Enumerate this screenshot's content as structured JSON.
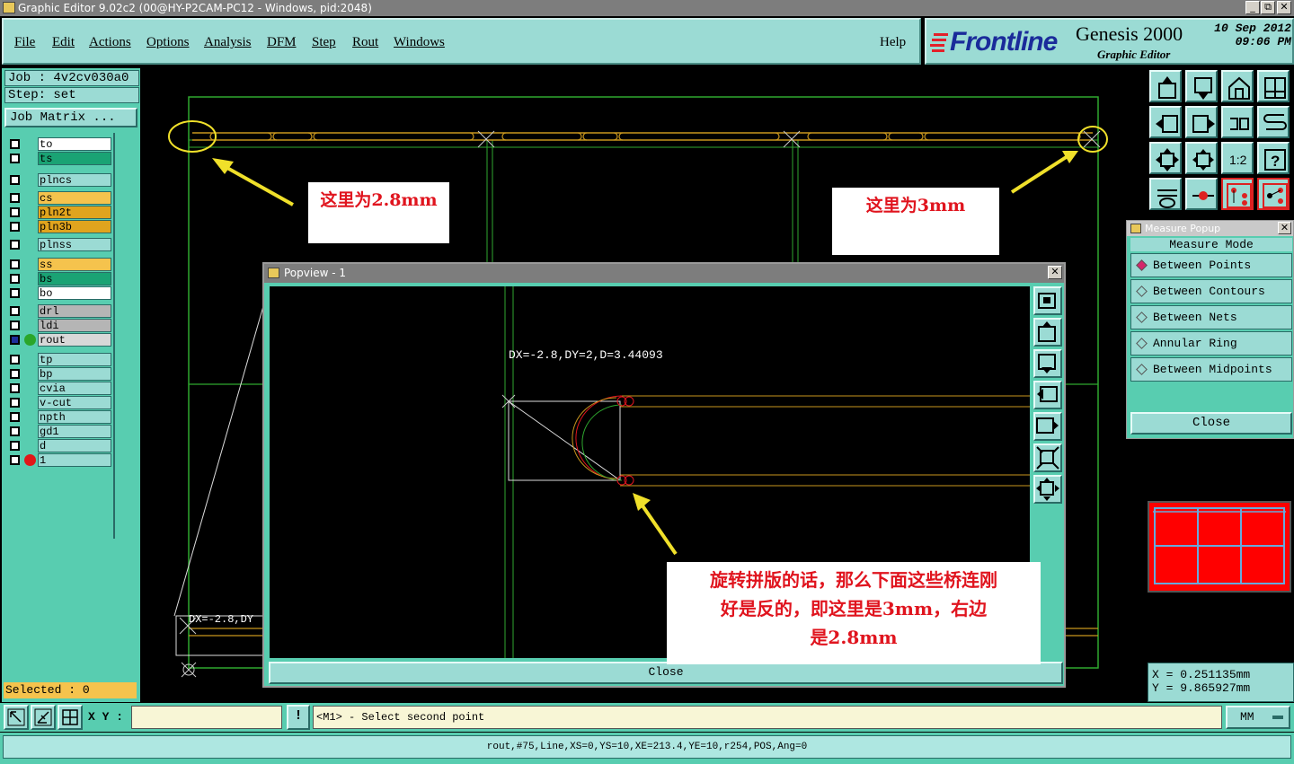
{
  "window": {
    "title": "Graphic Editor 9.02c2 (00@HY-P2CAM-PC12 - Windows, pid:2048)",
    "controls": [
      "_",
      "⧉",
      "✕"
    ]
  },
  "menu": {
    "items": [
      "File",
      "Edit",
      "Actions",
      "Options",
      "Analysis",
      "DFM",
      "Step",
      "Rout",
      "Windows"
    ],
    "help": "Help"
  },
  "brand": {
    "logo": "Frontline",
    "product": "Genesis 2000",
    "subtitle": "Graphic Editor",
    "date": "10  Sep  2012",
    "time": "09:06  PM"
  },
  "job": {
    "job_line": "Job  :  4v2cv030a0",
    "step_line": "Step:  set",
    "matrix_button": "Job Matrix ..."
  },
  "layers": [
    [
      {
        "name": "to",
        "color": "#ffffff"
      },
      {
        "name": "ts",
        "color": "#1aa374"
      }
    ],
    [
      {
        "name": "plncs",
        "color": "#9bdbd4"
      }
    ],
    [
      {
        "name": "cs",
        "color": "#f5c34d"
      },
      {
        "name": "pln2t",
        "color": "#e0a41e"
      },
      {
        "name": "pln3b",
        "color": "#e0a41e"
      }
    ],
    [
      {
        "name": "plnss",
        "color": "#9bdbd4"
      }
    ],
    [
      {
        "name": "ss",
        "color": "#f5c34d"
      },
      {
        "name": "bs",
        "color": "#1aa374"
      },
      {
        "name": "bo",
        "color": "#ffffff"
      }
    ],
    [
      {
        "name": "drl",
        "color": "#b5b5b5"
      },
      {
        "name": "ldi",
        "color": "#b5b5b5"
      },
      {
        "name": "rout",
        "color": "#d8d8d8",
        "active": true
      }
    ],
    [
      {
        "name": "tp",
        "color": "#9bdbd4"
      },
      {
        "name": "bp",
        "color": "#9bdbd4"
      },
      {
        "name": "cvia",
        "color": "#9bdbd4"
      },
      {
        "name": "v-cut",
        "color": "#9bdbd4"
      },
      {
        "name": "npth",
        "color": "#9bdbd4"
      },
      {
        "name": "gd1",
        "color": "#9bdbd4"
      },
      {
        "name": "d",
        "color": "#9bdbd4"
      },
      {
        "name": "1",
        "color": "#9bdbd4",
        "marker": true
      }
    ]
  ],
  "selected": "Selected : 0",
  "annotations": {
    "left": "这里为2.8mm",
    "right": "这里为3mm",
    "bottom_line1": "旋转拼版的话，那么下面这些桥连刚",
    "bottom_line2": "好是反的，即这里是3mm，右边",
    "bottom_line3": "是2.8mm"
  },
  "canvas": {
    "partial_measure": "DX=-2.8,DY"
  },
  "popview": {
    "title": "Popview - 1",
    "measure": "DX=-2.8,DY=2,D=3.44093",
    "close": "Close"
  },
  "measure_popup": {
    "title": "Measure Popup",
    "heading": "Measure Mode",
    "options": [
      "Between Points",
      "Between Contours",
      "Between Nets",
      "Annular Ring",
      "Between Midpoints"
    ],
    "selected_index": 0,
    "close": "Close"
  },
  "coords": {
    "x": "X  =  0.251135mm",
    "y": "Y  =  9.865927mm"
  },
  "bottom": {
    "xy_label": "X Y :",
    "xy_value": "",
    "alert": "!",
    "prompt": "<M1> - Select second point",
    "units": "MM"
  },
  "status": "rout,#75,Line,XS=0,YS=10,XE=213.4,YE=10,r254,POS,Ang=0"
}
